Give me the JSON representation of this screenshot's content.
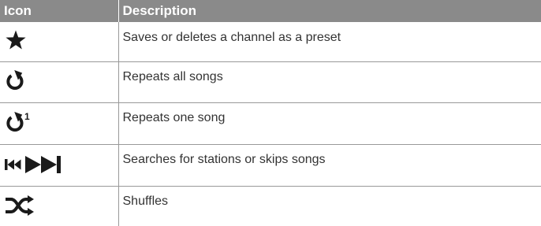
{
  "table": {
    "headers": {
      "icon": "Icon",
      "description": "Description"
    },
    "rows": [
      {
        "icon": "star-icon",
        "description": "Saves or deletes a channel as a preset"
      },
      {
        "icon": "repeat-all-icon",
        "description": "Repeats all songs"
      },
      {
        "icon": "repeat-one-icon",
        "icon_label": "1",
        "description": "Repeats one song"
      },
      {
        "icon": "skip-previous-next-icon",
        "description": "Searches for stations or skips songs"
      },
      {
        "icon": "shuffle-icon",
        "description": "Shuffles"
      }
    ]
  },
  "colors": {
    "header_background": "#8a8a8a",
    "header_text": "#ffffff",
    "icon": "#1a1a1a",
    "body_text": "#333333",
    "rule": "#999999"
  }
}
